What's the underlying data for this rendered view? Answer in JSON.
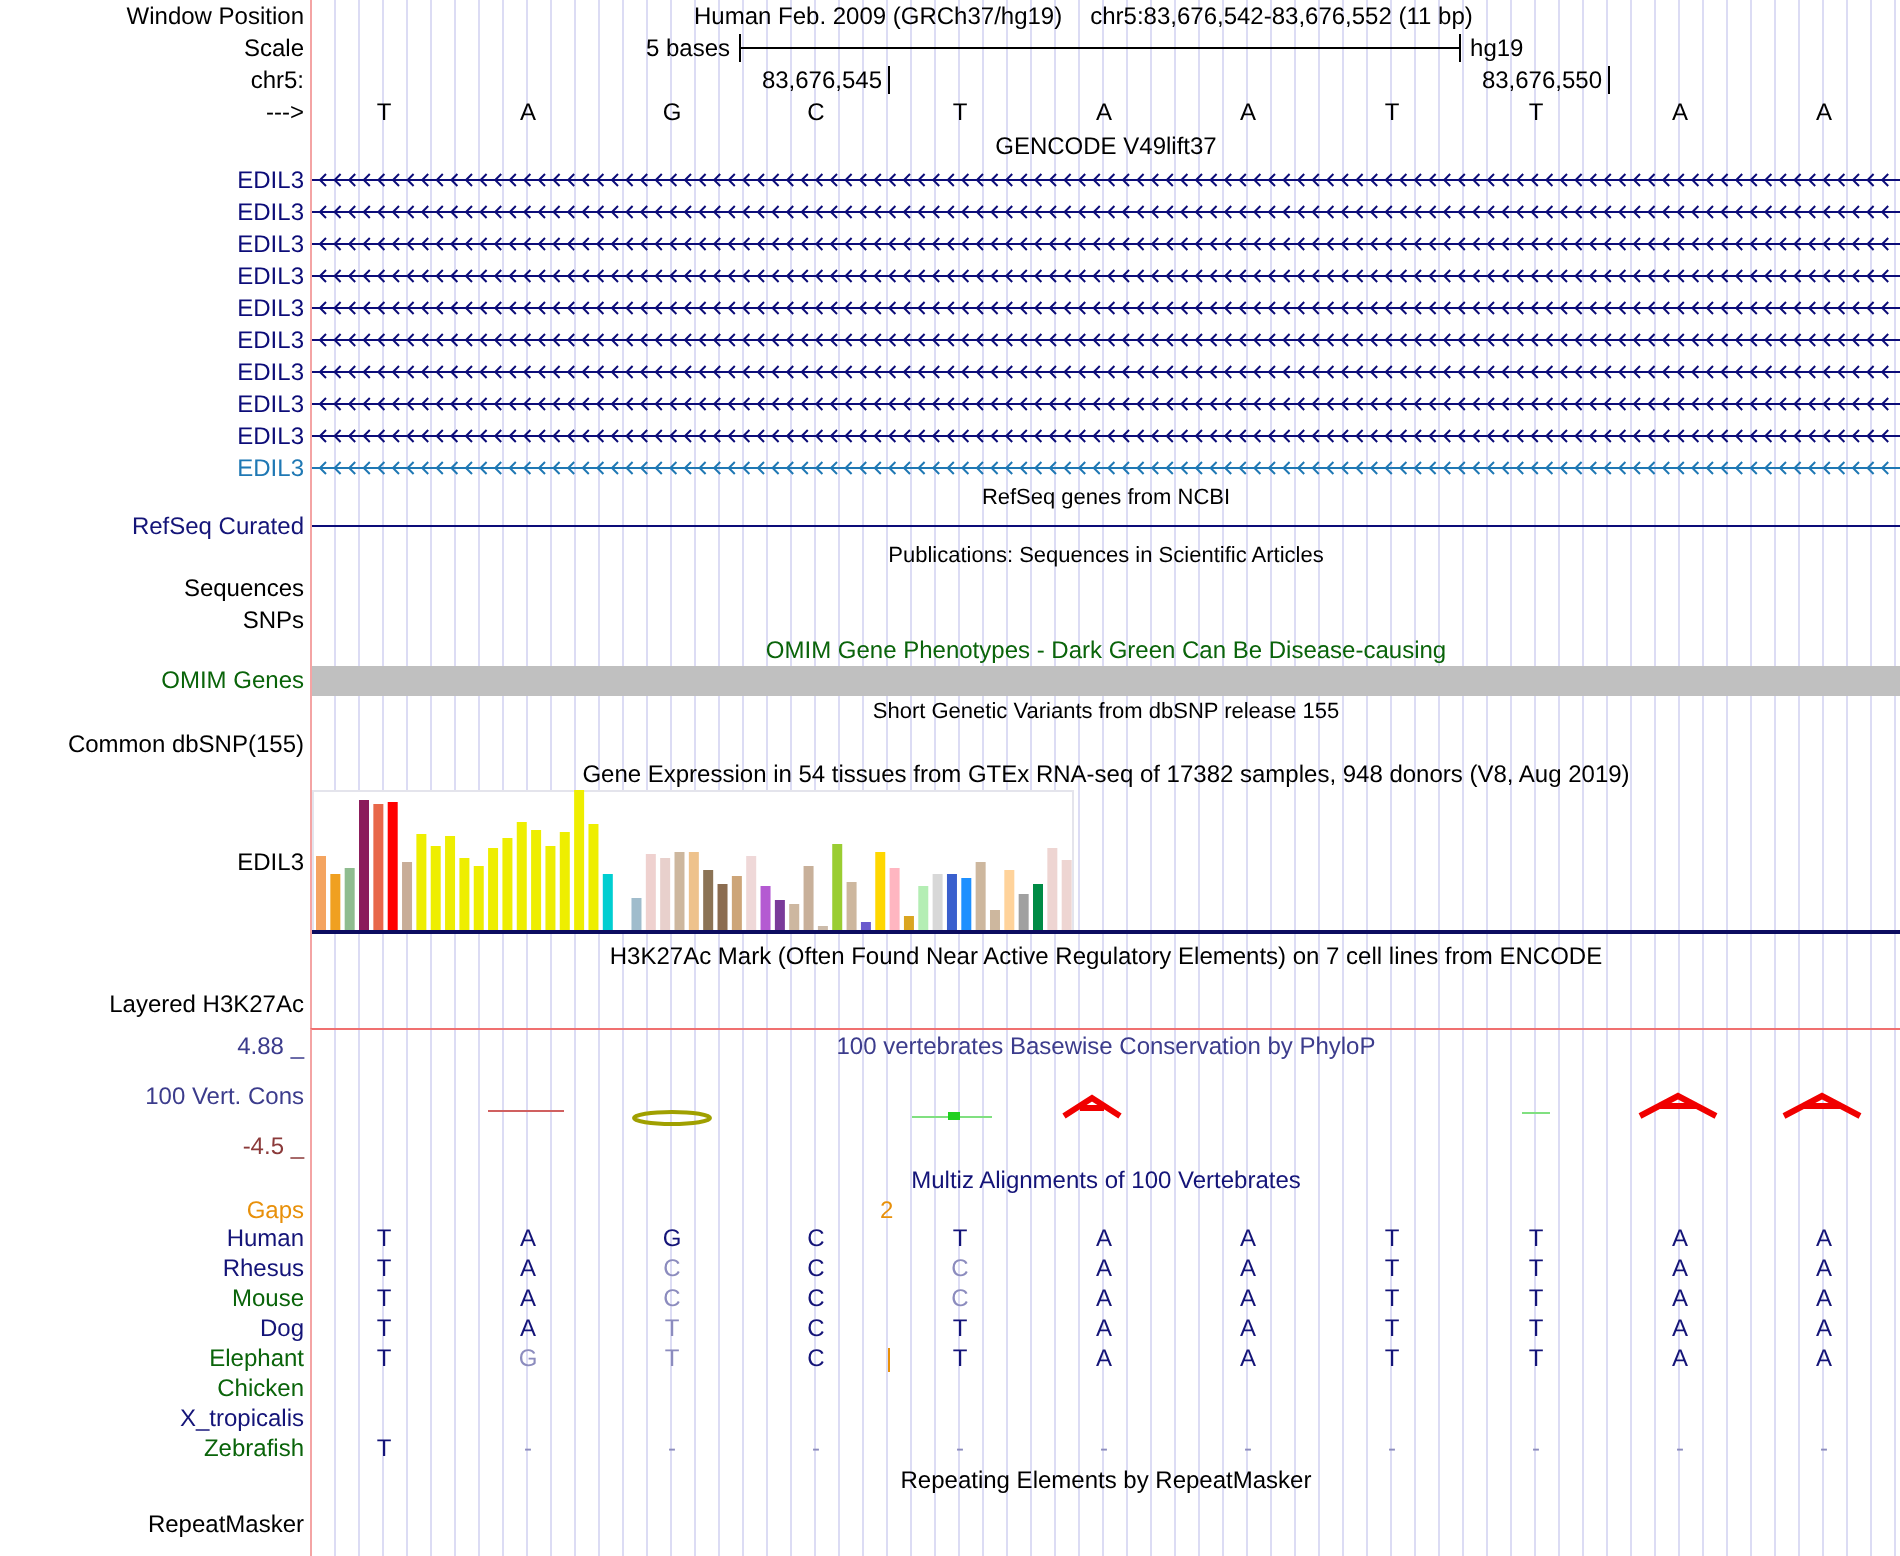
{
  "header": {
    "label": "Window Position",
    "assembly": "Human Feb. 2009 (GRCh37/hg19)",
    "position": "chr5:83,676,542-83,676,552 (11 bp)"
  },
  "scale": {
    "label": "Scale",
    "bar_label": "5 bases",
    "assembly": "hg19"
  },
  "coords": {
    "label": "chr5:",
    "ticks": [
      "83,676,545",
      "83,676,550"
    ]
  },
  "sequence": {
    "label": "--->",
    "bases": [
      "T",
      "A",
      "G",
      "C",
      "T",
      "A",
      "A",
      "T",
      "T",
      "A",
      "A"
    ]
  },
  "gencode": {
    "title": "GENCODE V49lift37",
    "genes": [
      {
        "name": "EDIL3",
        "color": "#0c0c78"
      },
      {
        "name": "EDIL3",
        "color": "#0c0c78"
      },
      {
        "name": "EDIL3",
        "color": "#0c0c78"
      },
      {
        "name": "EDIL3",
        "color": "#0c0c78"
      },
      {
        "name": "EDIL3",
        "color": "#0c0c78"
      },
      {
        "name": "EDIL3",
        "color": "#0c0c78"
      },
      {
        "name": "EDIL3",
        "color": "#0c0c78"
      },
      {
        "name": "EDIL3",
        "color": "#0c0c78"
      },
      {
        "name": "EDIL3",
        "color": "#0c0c78"
      },
      {
        "name": "EDIL3",
        "color": "#1f78b4"
      }
    ]
  },
  "refseq": {
    "title": "RefSeq genes from NCBI",
    "label": "RefSeq Curated"
  },
  "publications": {
    "title": "Publications: Sequences in Scientific Articles",
    "labels": [
      "Sequences",
      "SNPs"
    ]
  },
  "omim": {
    "title": "OMIM Gene Phenotypes - Dark Green Can Be Disease-causing",
    "label": "OMIM Genes"
  },
  "dbsnp": {
    "title": "Short Genetic Variants from dbSNP release 155",
    "label": "Common dbSNP(155)"
  },
  "gtex": {
    "title": "Gene Expression in 54 tissues from GTEx RNA-seq of 17382 samples, 948 donors (V8, Aug 2019)",
    "label": "EDIL3"
  },
  "h3k27ac": {
    "title": "H3K27Ac Mark (Often Found Near Active Regulatory Elements) on 7 cell lines from ENCODE",
    "label": "Layered H3K27Ac"
  },
  "conservation": {
    "title": "100 vertebrates Basewise Conservation by PhyloP",
    "label": "100 Vert. Cons",
    "max": "4.88 _",
    "min": "-4.5 _"
  },
  "multiz": {
    "title": "Multiz Alignments of 100 Vertebrates",
    "gaps": {
      "label": "Gaps",
      "count": "2"
    },
    "species": [
      {
        "name": "Human",
        "color": "#141478",
        "insertion": false,
        "bases": [
          {
            "base": "T",
            "match": true
          },
          {
            "base": "A",
            "match": true
          },
          {
            "base": "G",
            "match": true
          },
          {
            "base": "C",
            "match": true
          },
          {
            "base": "T",
            "match": true
          },
          {
            "base": "A",
            "match": true
          },
          {
            "base": "A",
            "match": true
          },
          {
            "base": "T",
            "match": true
          },
          {
            "base": "T",
            "match": true
          },
          {
            "base": "A",
            "match": true
          },
          {
            "base": "A",
            "match": true
          }
        ]
      },
      {
        "name": "Rhesus",
        "color": "#141478",
        "insertion": false,
        "bases": [
          {
            "base": "T",
            "match": true
          },
          {
            "base": "A",
            "match": true
          },
          {
            "base": "C",
            "match": false
          },
          {
            "base": "C",
            "match": true
          },
          {
            "base": "C",
            "match": false
          },
          {
            "base": "A",
            "match": true
          },
          {
            "base": "A",
            "match": true
          },
          {
            "base": "T",
            "match": true
          },
          {
            "base": "T",
            "match": true
          },
          {
            "base": "A",
            "match": true
          },
          {
            "base": "A",
            "match": true
          }
        ]
      },
      {
        "name": "Mouse",
        "color": "#0a640a",
        "insertion": false,
        "bases": [
          {
            "base": "T",
            "match": true
          },
          {
            "base": "A",
            "match": true
          },
          {
            "base": "C",
            "match": false
          },
          {
            "base": "C",
            "match": true
          },
          {
            "base": "C",
            "match": false
          },
          {
            "base": "A",
            "match": true
          },
          {
            "base": "A",
            "match": true
          },
          {
            "base": "T",
            "match": true
          },
          {
            "base": "T",
            "match": true
          },
          {
            "base": "A",
            "match": true
          },
          {
            "base": "A",
            "match": true
          }
        ]
      },
      {
        "name": "Dog",
        "color": "#141478",
        "insertion": false,
        "bases": [
          {
            "base": "T",
            "match": true
          },
          {
            "base": "A",
            "match": true
          },
          {
            "base": "T",
            "match": false
          },
          {
            "base": "C",
            "match": true
          },
          {
            "base": "T",
            "match": true
          },
          {
            "base": "A",
            "match": true
          },
          {
            "base": "A",
            "match": true
          },
          {
            "base": "T",
            "match": true
          },
          {
            "base": "T",
            "match": true
          },
          {
            "base": "A",
            "match": true
          },
          {
            "base": "A",
            "match": true
          }
        ]
      },
      {
        "name": "Elephant",
        "color": "#0a640a",
        "insertion": true,
        "bases": [
          {
            "base": "T",
            "match": true
          },
          {
            "base": "G",
            "match": false
          },
          {
            "base": "T",
            "match": false
          },
          {
            "base": "C",
            "match": true
          },
          {
            "base": "T",
            "match": true
          },
          {
            "base": "A",
            "match": true
          },
          {
            "base": "A",
            "match": true
          },
          {
            "base": "T",
            "match": true
          },
          {
            "base": "T",
            "match": true
          },
          {
            "base": "A",
            "match": true
          },
          {
            "base": "A",
            "match": true
          }
        ]
      },
      {
        "name": "Chicken",
        "color": "#0a640a",
        "insertion": false
      },
      {
        "name": "X_tropicalis",
        "color": "#141478",
        "insertion": false
      },
      {
        "name": "Zebrafish",
        "color": "#0a640a",
        "insertion": false,
        "bases": [
          {
            "base": "T",
            "match": true
          },
          {
            "base": "-",
            "match": false
          },
          {
            "base": "-",
            "match": false
          },
          {
            "base": "-",
            "match": false
          },
          {
            "base": "-",
            "match": false
          },
          {
            "base": "-",
            "match": false
          },
          {
            "base": "-",
            "match": false
          },
          {
            "base": "-",
            "match": false
          },
          {
            "base": "-",
            "match": false
          },
          {
            "base": "-",
            "match": false
          },
          {
            "base": "-",
            "match": false
          }
        ]
      }
    ]
  },
  "repeatmasker": {
    "title": "Repeating Elements by RepeatMasker",
    "label": "RepeatMasker"
  }
}
